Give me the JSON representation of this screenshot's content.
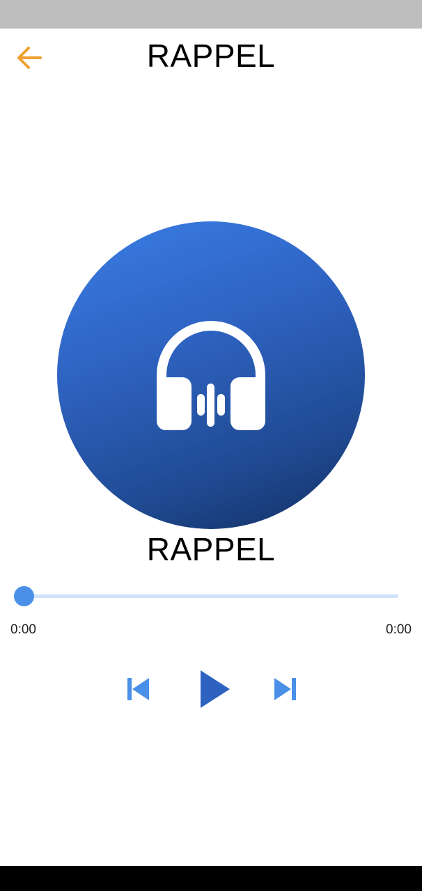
{
  "header": {
    "title": "RAPPEL",
    "back_icon": "arrow-left-icon",
    "back_color": "#f0a030"
  },
  "artwork": {
    "icon": "headphones-icon"
  },
  "track": {
    "title": "RAPPEL"
  },
  "player": {
    "position": "0:00",
    "duration": "0:00",
    "progress": 0,
    "accent": "#4a8fe8",
    "controls": {
      "previous_icon": "skip-previous-icon",
      "play_icon": "play-icon",
      "next_icon": "skip-next-icon"
    }
  }
}
